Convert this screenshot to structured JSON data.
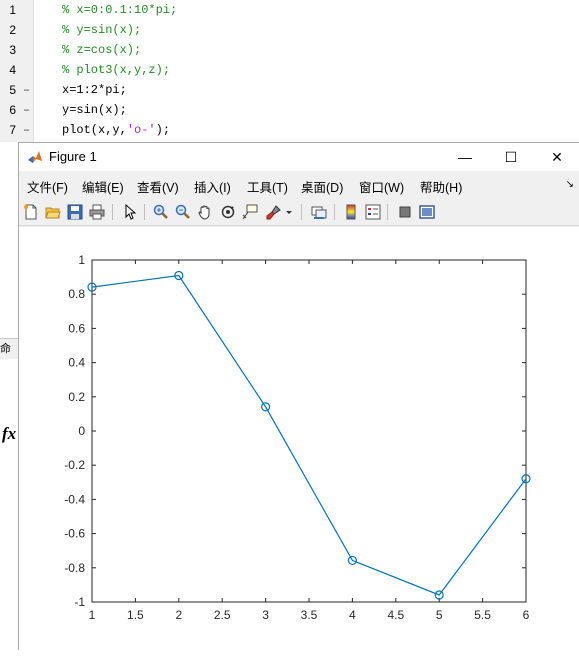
{
  "editor": {
    "lines": [
      {
        "num": "1",
        "dash": "",
        "code": "% x=0:0.1:10*pi;",
        "kind": "comment"
      },
      {
        "num": "2",
        "dash": "",
        "code": "% y=sin(x);",
        "kind": "comment"
      },
      {
        "num": "3",
        "dash": "",
        "code": "% z=cos(x);",
        "kind": "comment"
      },
      {
        "num": "4",
        "dash": "",
        "code": "% plot3(x,y,z);",
        "kind": "comment"
      },
      {
        "num": "5",
        "dash": "–",
        "code": "x=1:2*pi;",
        "kind": "plain"
      },
      {
        "num": "6",
        "dash": "–",
        "code": "y=sin(x);",
        "kind": "plain"
      },
      {
        "num": "7",
        "dash": "–",
        "code_prefix": "plot(x,y,",
        "code_string": "'o-'",
        "code_suffix": ");",
        "kind": "mixed"
      }
    ]
  },
  "command_window": {
    "tab_label": "命",
    "fx_label": "fx"
  },
  "figure": {
    "title": "Figure 1",
    "window_buttons": {
      "minimize": "—",
      "maximize": "☐",
      "close": "✕"
    },
    "menu": [
      {
        "label": "文件(F)"
      },
      {
        "label": "编辑(E)"
      },
      {
        "label": "查看(V)"
      },
      {
        "label": "插入(I)"
      },
      {
        "label": "工具(T)"
      },
      {
        "label": "桌面(D)"
      },
      {
        "label": "窗口(W)"
      },
      {
        "label": "帮助(H)"
      }
    ],
    "menu_overflow": "↘",
    "toolbar": [
      "new-figure-icon",
      "open-file-icon",
      "save-icon",
      "print-icon",
      "select-pointer-icon",
      "zoom-in-icon",
      "zoom-out-icon",
      "pan-icon",
      "rotate-3d-icon",
      "data-cursor-icon",
      "brush-icon",
      "brush-dropdown-icon",
      "link-plot-icon",
      "colorbar-icon",
      "legend-icon",
      "hide-plot-tools-icon",
      "show-plot-tools-icon"
    ]
  },
  "chart_data": {
    "type": "line",
    "x": [
      1,
      2,
      3,
      4,
      5,
      6
    ],
    "y": [
      0.8415,
      0.9093,
      0.1411,
      -0.7568,
      -0.9589,
      -0.2794
    ],
    "marker": "circle",
    "line_color": "#0072bd",
    "xlim": [
      1,
      6
    ],
    "ylim": [
      -1,
      1
    ],
    "xticks": [
      "1",
      "1.5",
      "2",
      "2.5",
      "3",
      "3.5",
      "4",
      "4.5",
      "5",
      "5.5",
      "6"
    ],
    "yticks": [
      "-1",
      "-0.8",
      "-0.6",
      "-0.4",
      "-0.2",
      "0",
      "0.2",
      "0.4",
      "0.6",
      "0.8",
      "1"
    ],
    "grid": false
  }
}
